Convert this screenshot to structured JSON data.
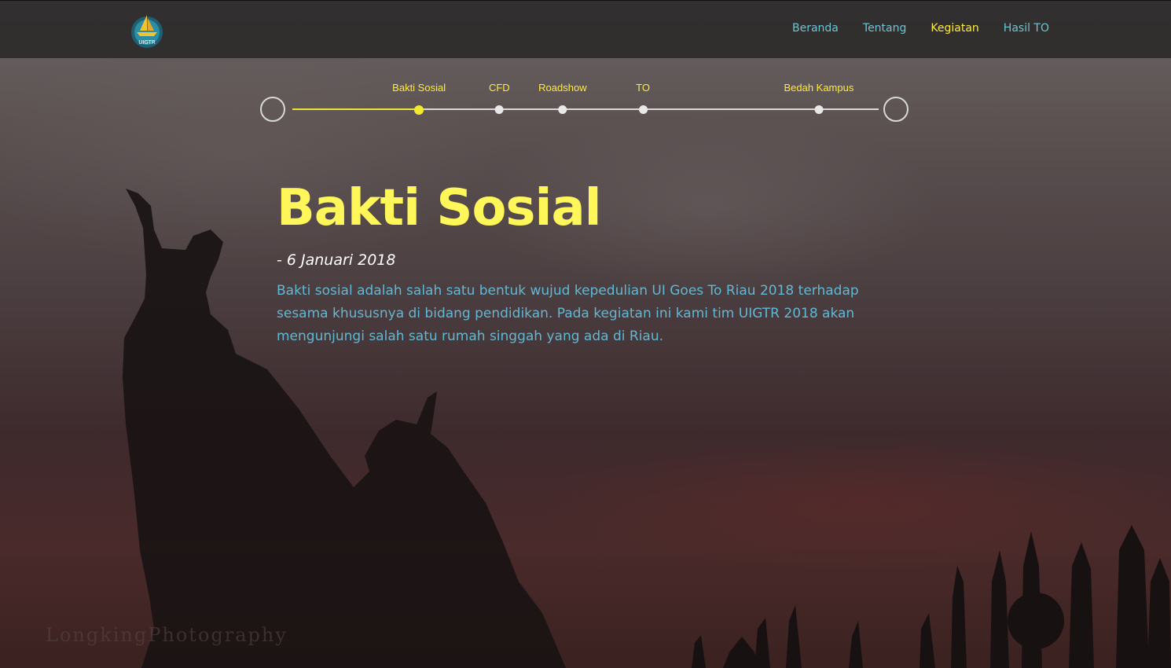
{
  "nav": {
    "logo_text": "UIGTR",
    "links": [
      {
        "label": "Beranda",
        "active": false
      },
      {
        "label": "Tentang",
        "active": false
      },
      {
        "label": "Kegiatan",
        "active": true
      },
      {
        "label": "Hasil TO",
        "active": false
      }
    ]
  },
  "timeline": {
    "progress": 0.216,
    "items": [
      {
        "label": "Bakti Sosial",
        "position": 0.216,
        "active": true
      },
      {
        "label": "CFD",
        "position": 0.353,
        "active": false
      },
      {
        "label": "Roadshow",
        "position": 0.461,
        "active": false
      },
      {
        "label": "TO",
        "position": 0.598,
        "active": false
      },
      {
        "label": "Bedah Kampus",
        "position": 0.898,
        "active": false
      }
    ]
  },
  "event": {
    "title": "Bakti Sosial",
    "date": "- 6 Januari 2018",
    "description": "Bakti sosial adalah salah satu bentuk wujud kepedulian UI Goes To Riau 2018 terhadap sesama khususnya di bidang pendidikan. Pada kegiatan ini kami tim UIGTR 2018 akan mengunjungi salah satu rumah singgah yang ada di Riau."
  },
  "watermark": "LongkingPhotography",
  "colors": {
    "accent_yellow": "#fff65a",
    "nav_link": "#6cc5d6",
    "description_text": "#62b8d3"
  }
}
